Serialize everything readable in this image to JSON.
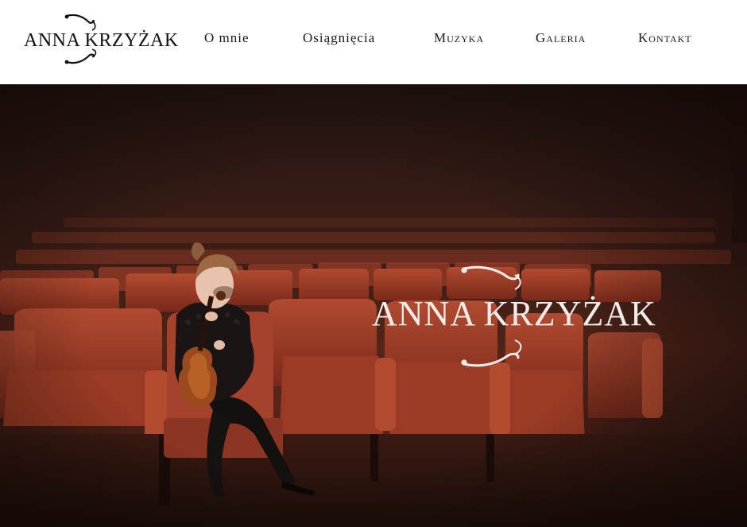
{
  "brand": {
    "name": "ANNA KRZYŻAK"
  },
  "nav": {
    "items": [
      {
        "label": "O mnie"
      },
      {
        "label": "Osiągnięcia"
      },
      {
        "label": "Muzyka"
      },
      {
        "label": "Galeria"
      },
      {
        "label": "Kontakt"
      }
    ]
  },
  "hero": {
    "title": "ANNA KRZYŻAK",
    "image": "violinist-in-concert-hall-seats"
  },
  "colors": {
    "header_bg": "#ffffff",
    "text_dark": "#1a1a1a",
    "hero_text": "#f4ece8",
    "seat_red": "#a8442c",
    "hero_bg": "#2a1713"
  }
}
